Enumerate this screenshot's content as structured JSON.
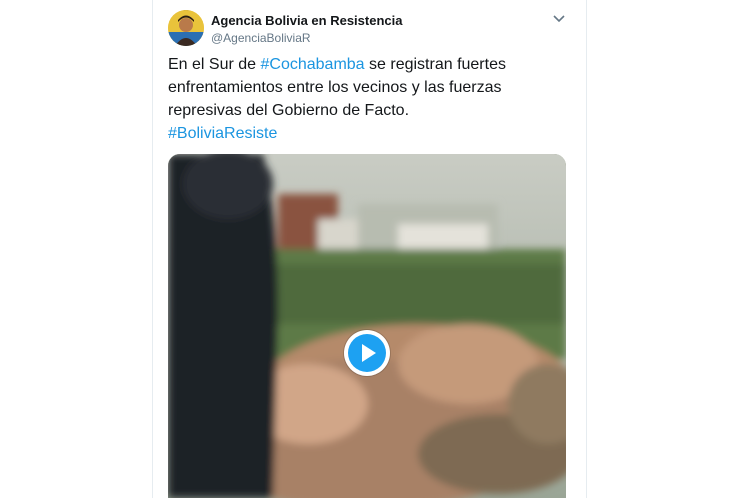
{
  "tweet": {
    "author_name": "Agencia Bolivia en Resistencia",
    "author_handle": "@AgenciaBoliviaR",
    "text_part1": "En el Sur de ",
    "hashtag1": "#Cochabamba",
    "text_part2": " se registran fuertes enfrentamientos entre los vecinos y las fuerzas represivas del Gobierno de Facto.",
    "hashtag2": "#BoliviaResiste"
  },
  "icons": {
    "menu": "chevron-down-icon",
    "play": "play-icon"
  },
  "colors": {
    "hashtag": "#1b95e0",
    "play_button": "#1da1f2",
    "name": "#14171a",
    "handle": "#657786"
  }
}
